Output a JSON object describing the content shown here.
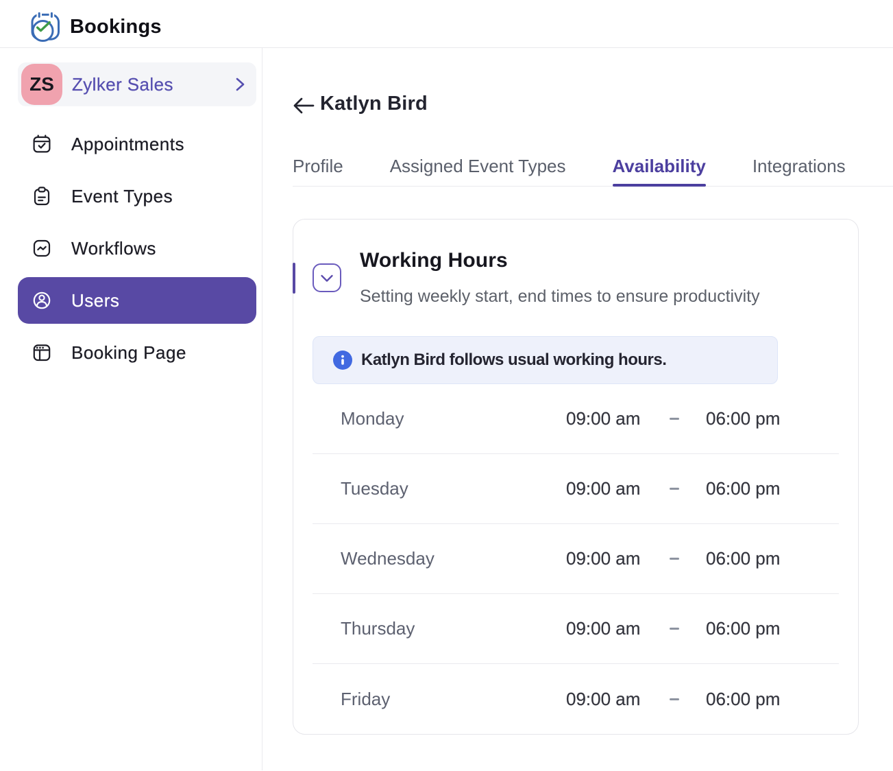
{
  "brand": {
    "name": "Bookings",
    "logo_icon": "bookings-calendar-check-icon"
  },
  "colors": {
    "purple": "#5849a4",
    "purple_text": "#564fb0",
    "tab_active_purple": "#4c3f9f",
    "avatar_pink": "#f0a2ae",
    "banner_blue": "#4169e1",
    "logo_blue": "#3a6cb5",
    "logo_green": "#3f9b47"
  },
  "sidebar": {
    "org": {
      "initials": "ZS",
      "name": "Zylker Sales",
      "chevron_icon": "chevron-right-icon"
    },
    "items": [
      {
        "label": "Appointments",
        "icon": "calendar-check-icon",
        "active": false
      },
      {
        "label": "Event Types",
        "icon": "clipboard-icon",
        "active": false
      },
      {
        "label": "Workflows",
        "icon": "workflow-pulse-icon",
        "active": false
      },
      {
        "label": "Users",
        "icon": "user-circle-icon",
        "active": true
      },
      {
        "label": "Booking Page",
        "icon": "browser-layout-icon",
        "active": false
      }
    ]
  },
  "main": {
    "back_icon": "back-arrow-icon",
    "title": "Katlyn Bird",
    "tabs": [
      {
        "label": "Profile",
        "active": false
      },
      {
        "label": "Assigned Event Types",
        "active": false
      },
      {
        "label": "Availability",
        "active": true
      },
      {
        "label": "Integrations",
        "active": false
      }
    ],
    "card": {
      "title": "Working Hours",
      "subtitle": "Setting weekly start, end times to ensure productivity",
      "collapse_icon": "chevron-down-icon",
      "banner": {
        "icon": "info-icon",
        "text": "Katlyn Bird follows usual working hours."
      },
      "rows": [
        {
          "day": "Monday",
          "start": "09:00 am",
          "end": "06:00 pm"
        },
        {
          "day": "Tuesday",
          "start": "09:00 am",
          "end": "06:00 pm"
        },
        {
          "day": "Wednesday",
          "start": "09:00 am",
          "end": "06:00 pm"
        },
        {
          "day": "Thursday",
          "start": "09:00 am",
          "end": "06:00 pm"
        },
        {
          "day": "Friday",
          "start": "09:00 am",
          "end": "06:00 pm"
        }
      ]
    }
  }
}
